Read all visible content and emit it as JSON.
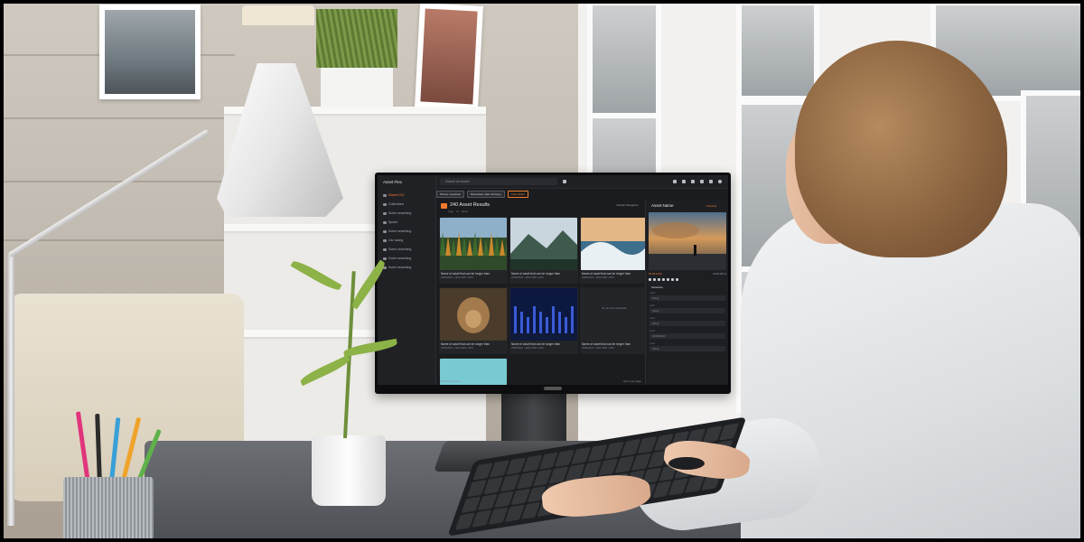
{
  "app": {
    "name": "Asset Flex",
    "search_placeholder": "Search all assets"
  },
  "sidebar": {
    "items": [
      {
        "label": "Market 212",
        "active": true
      },
      {
        "label": "Collections",
        "active": false
      },
      {
        "label": "Some searching",
        "active": false
      },
      {
        "label": "Sports",
        "active": false
      },
      {
        "label": "Some searching",
        "active": false
      },
      {
        "label": "Car racing",
        "active": false
      },
      {
        "label": "Some searching",
        "active": false
      },
      {
        "label": "Some searching",
        "active": false
      },
      {
        "label": "Some searching",
        "active": false
      }
    ]
  },
  "filters": {
    "chips": [
      "Picture resolution",
      "Bestsellers (last 30 days)",
      "Clear filters"
    ]
  },
  "results": {
    "count": "240",
    "title": "Asset Results",
    "columns": [
      "Type",
      "Id",
      "Name"
    ],
    "sort": "Default Navigation"
  },
  "assets": [
    {
      "name": "Name of asset that can be longer than",
      "meta": "25/06/2024 • 1920x1080 • MP4",
      "preview": "forest"
    },
    {
      "name": "Name of asset that can be longer than",
      "meta": "25/06/2024 • 1920x1080 • MP4",
      "preview": "mountain"
    },
    {
      "name": "Name of asset that can be longer than",
      "meta": "25/06/2024 • 1920x1080 • MP4",
      "preview": "wave"
    },
    {
      "name": "Name of asset that can be longer than",
      "meta": "25/06/2024 • 1920x1080 • MP4",
      "preview": "sunset"
    },
    {
      "name": "Name of asset that can be longer than",
      "meta": "25/06/2024 • 1920x1080 • MP4",
      "preview": "lion"
    },
    {
      "name": "Name of asset that can be longer than",
      "meta": "25/06/2024 • 1920x1080 • MP4",
      "preview": "city"
    },
    {
      "name": "Name of asset that can be longer than",
      "meta": "25/06/2024 • 1920x1080 • MP4",
      "preview": "none",
      "no_preview_text": "No preview available"
    },
    {
      "name": "",
      "meta": "",
      "preview": "beach"
    },
    {
      "name": "",
      "meta": "",
      "preview": "teal"
    }
  ],
  "detail": {
    "title": "Asset Name",
    "tag": "Preview",
    "timecode": "00:00:12:00",
    "duration": "00:00:28:12",
    "section": "Metadata",
    "fields": [
      {
        "label": "Label",
        "value": "String"
      },
      {
        "label": "Label",
        "value": "String"
      },
      {
        "label": "Label",
        "value": "String"
      },
      {
        "label": "Label",
        "value": "10/06/2024"
      },
      {
        "label": "Label",
        "value": "String"
      }
    ]
  },
  "status": {
    "left": "176 items in view",
    "right": "Items per page"
  },
  "colors": {
    "accent": "#f07a2b",
    "screen_bg": "#1b1c1f"
  }
}
